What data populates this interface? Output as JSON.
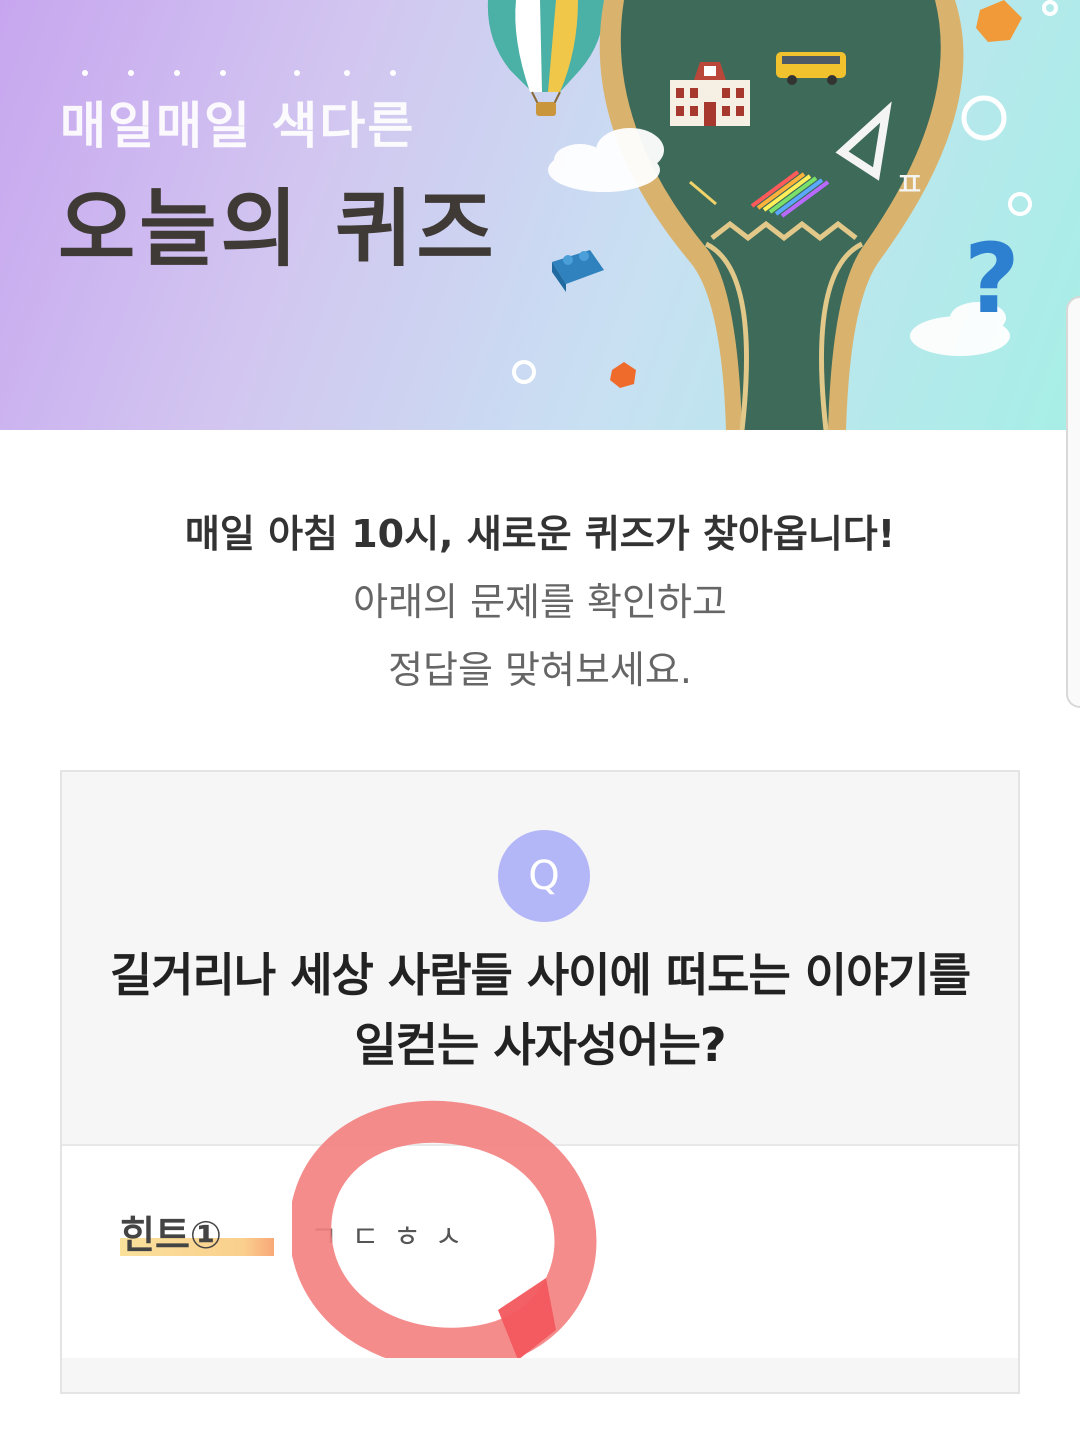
{
  "banner": {
    "subtitle": "매일매일 색다른",
    "title": "오늘의 퀴즈"
  },
  "intro": {
    "line1": "매일 아침 10시, 새로운 퀴즈가 찾아옵니다!",
    "line2": "아래의 문제를 확인하고",
    "line3": "정답을 맞혀보세요."
  },
  "quiz": {
    "badge": "Q",
    "question_line1": "길거리나 세상 사람들 사이에 떠도는 이야기를",
    "question_line2": "일컫는 사자성어는?",
    "hint_label": "힌트①",
    "hint_value": "ㄱㄷㅎㅅ"
  },
  "colors": {
    "badge": "#b3b7f7",
    "annotation_circle": "#f47f80",
    "hint_highlight": "#f9dc8a"
  },
  "icons": [
    "hot-air-balloon-icon",
    "lightbulb-chalkboard-icon",
    "school-building-icon",
    "school-bus-icon",
    "triangle-ruler-icon",
    "colored-pencils-icon",
    "question-mark-icon",
    "lego-brick-icon",
    "cloud-icon",
    "gem-icon"
  ]
}
